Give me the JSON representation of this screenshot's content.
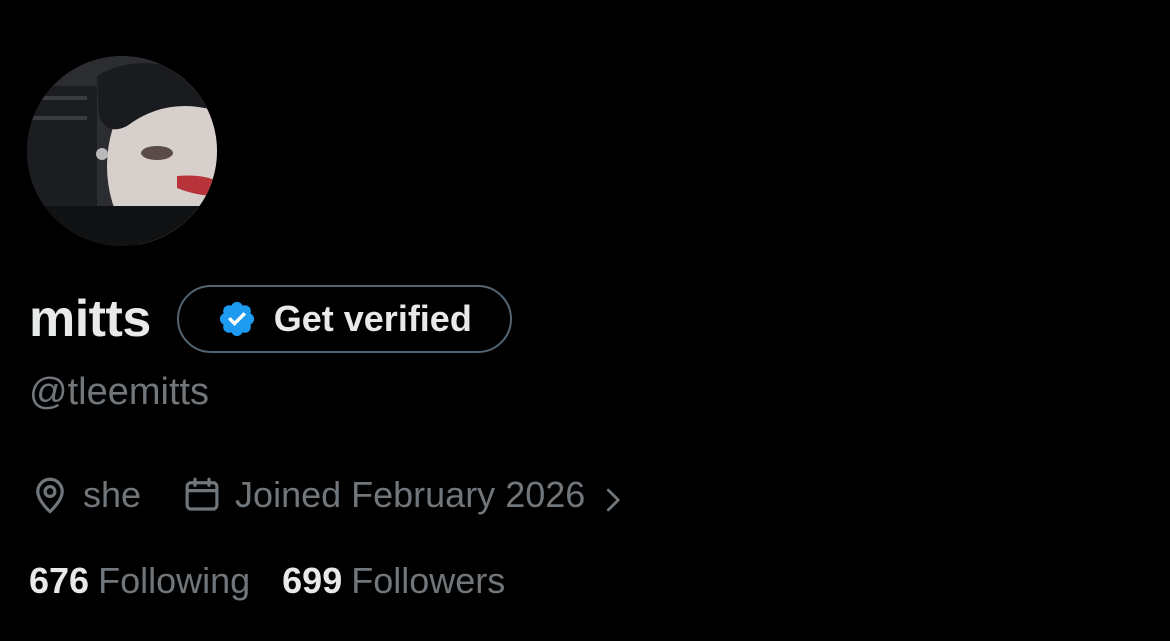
{
  "profile": {
    "display_name": "mitts",
    "handle": "@tleemitts",
    "avatar_icon": "avatar-photo"
  },
  "verify_button": {
    "label": "Get verified",
    "icon": "verified-badge-icon",
    "badge_color": "#1d9bf0"
  },
  "meta": {
    "location": "she",
    "location_icon": "location-pin-icon",
    "joined": "Joined February 2026",
    "joined_icon": "calendar-icon",
    "chevron_icon": "chevron-right-icon"
  },
  "stats": {
    "following_count": "676",
    "following_label": "Following",
    "followers_count": "699",
    "followers_label": "Followers"
  },
  "colors": {
    "background": "#000000",
    "primary_text": "#e7e9ea",
    "secondary_text": "#71767b",
    "button_border": "#536471"
  }
}
